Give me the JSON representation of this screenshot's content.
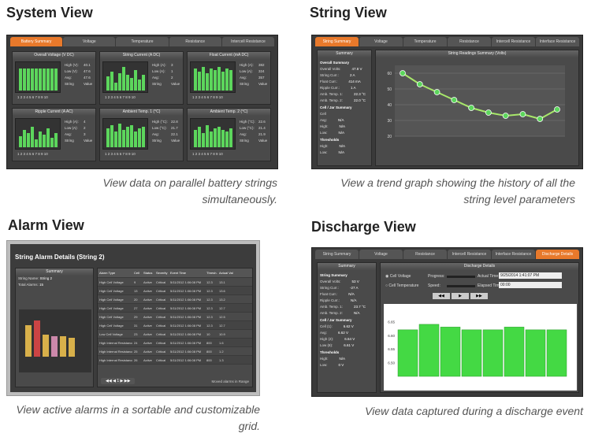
{
  "sections": {
    "system": {
      "title": "System View",
      "caption": "View data on parallel battery strings simultaneously.",
      "tabs": [
        "Battery Summary",
        "Voltage",
        "Temperature",
        "Resistance",
        "Intercell Resistance"
      ],
      "panels": [
        {
          "title": "Overall Voltage (V DC)",
          "axis": [
            "53.0",
            "47.5",
            "42.0",
            "36.5"
          ],
          "stats": [
            "High (V):",
            "40.1",
            "Low (V):",
            "47.6",
            "Avg:",
            "47.6",
            "String",
            "Value"
          ]
        },
        {
          "title": "String Current (A DC)",
          "axis": [
            "8.0",
            "4.0",
            "0.0",
            "-4.0"
          ],
          "stats": [
            "High (A):",
            "3",
            "Low (A):",
            "1",
            "Avg:",
            "2",
            "String",
            "Value"
          ]
        },
        {
          "title": "Float Current (mA DC)",
          "axis": [
            "432",
            "392",
            "352",
            "312"
          ],
          "stats": [
            "High (A):",
            "382",
            "Low (A):",
            "324",
            "Avg:",
            "357",
            "String",
            "Value"
          ]
        },
        {
          "title": "Ripple Current (A AC)",
          "axis": [
            "6.0",
            "4.0",
            "2.0",
            "0.0"
          ],
          "stats": [
            "High (A):",
            "4",
            "Low (A):",
            "2",
            "Avg:",
            "3",
            "String",
            "Value"
          ]
        },
        {
          "title": "Ambient Temp. 1 (°C)",
          "axis": [
            "23.0",
            "22.0",
            "21.0",
            "20.0"
          ],
          "stats": [
            "High (°C):",
            "22.8",
            "Low (°C):",
            "21.7",
            "Avg:",
            "22.1",
            "String",
            "Value"
          ]
        },
        {
          "title": "Ambient Temp. 2 (°C)",
          "axis": [
            "23.0",
            "22.0",
            "21.0",
            "20.0"
          ],
          "stats": [
            "High (°C):",
            "22.6",
            "Low (°C):",
            "21.4",
            "Avg:",
            "21.9",
            "String",
            "Value"
          ]
        }
      ],
      "xticks": "1 2 3 4 5 6 7 8 9 10"
    },
    "string": {
      "title": "String View",
      "caption": "View a trend graph showing the history of all the string level parameters",
      "tabs": [
        "String Summary",
        "Voltage",
        "Temperature",
        "Resistance",
        "Intercell Resistance",
        "Interface Resistance"
      ],
      "summary_head": "Summary",
      "chart_head": "String Readings Summary (Volts)",
      "summary": [
        {
          "label": "Overall Summary",
          "value": "",
          "head": true
        },
        {
          "label": "Overall Volts:",
          "value": "47.8 V"
        },
        {
          "label": "String Curr.:",
          "value": "2 A"
        },
        {
          "label": "Float Curr.:",
          "value": "414 mA"
        },
        {
          "label": "Ripple Curr.:",
          "value": "1 A"
        },
        {
          "label": "Amb. Temp. 1:",
          "value": "22.3 °C"
        },
        {
          "label": "Amb. Temp. 2:",
          "value": "22.0 °C"
        },
        {
          "label": "Cell / Jar Summary",
          "value": "",
          "head": true
        },
        {
          "label": "Cell",
          "value": ""
        },
        {
          "label": "Avg:",
          "value": "N/A"
        },
        {
          "label": "High:",
          "value": "N/A"
        },
        {
          "label": "Low:",
          "value": "N/A"
        },
        {
          "label": "Thresholds",
          "value": "",
          "head": true
        },
        {
          "label": "High:",
          "value": "N/A"
        },
        {
          "label": "Low:",
          "value": "N/A"
        }
      ]
    },
    "alarm": {
      "title": "Alarm View",
      "caption": "View active alarms in a sortable and customizable grid.",
      "header": "String Alarm Details (String 2)",
      "summary_head": "Summary",
      "string_name_label": "String Name:",
      "string_name": "String 2",
      "total_alarms_label": "Total Alarms:",
      "total_alarms": "15",
      "columns": [
        "Alarm Type",
        "Cell",
        "Status",
        "Severity",
        "Event Time",
        "Thresh. Value",
        "Actual Value"
      ],
      "rows": [
        [
          "High Cell Voltage",
          "9",
          "Active",
          "Critical",
          "5/11/2012 1:06:08 PM",
          "12.3",
          "13.1"
        ],
        [
          "High Cell Voltage",
          "13",
          "Active",
          "Critical",
          "5/11/2012 1:06:08 PM",
          "12.3",
          "13.6"
        ],
        [
          "High Cell Voltage",
          "20",
          "Active",
          "Critical",
          "5/11/2012 1:06:08 PM",
          "12.3",
          "13.2"
        ],
        [
          "High Cell Voltage",
          "27",
          "Active",
          "Critical",
          "5/11/2012 1:06:08 PM",
          "12.3",
          "12.7"
        ],
        [
          "High Cell Voltage",
          "29",
          "Active",
          "Critical",
          "5/11/2012 1:06:08 PM",
          "12.3",
          "12.5"
        ],
        [
          "High Cell Voltage",
          "31",
          "Active",
          "Critical",
          "5/11/2012 1:06:08 PM",
          "12.3",
          "12.7"
        ],
        [
          "Low Cell Voltage",
          "23",
          "Active",
          "Critical",
          "5/11/2012 1:06:08 PM",
          "10",
          "10.9"
        ],
        [
          "High Internal Resistance",
          "24",
          "Active",
          "Critical",
          "5/11/2012 1:06:08 PM",
          "800",
          "1.6"
        ],
        [
          "High Internal Resistance",
          "25",
          "Active",
          "Critical",
          "5/11/2012 1:06:08 PM",
          "800",
          "1.2"
        ],
        [
          "High Internal Resistance",
          "26",
          "Active",
          "Critical",
          "5/11/2012 1:06:08 PM",
          "800",
          "1.3"
        ]
      ],
      "pager": "1",
      "footer": "Moved alarms in Range"
    },
    "discharge": {
      "title": "Discharge View",
      "caption": "View data captured during a discharge event",
      "tabs": [
        "String Summary",
        "Voltage",
        "Resistance",
        "Intercell Resistance",
        "Interface Resistance",
        "Discharge Details"
      ],
      "summary_head": "Summary",
      "details_head": "Discharge Details",
      "summary": [
        {
          "label": "String Summary",
          "value": "",
          "head": true
        },
        {
          "label": "Overall Volts:",
          "value": "53 V"
        },
        {
          "label": "String Curr.:",
          "value": "-27 A"
        },
        {
          "label": "Float Curr.:",
          "value": "N/A"
        },
        {
          "label": "Ripple Curr.:",
          "value": "N/A"
        },
        {
          "label": "Amb. Temp. 1:",
          "value": "23.7 °C"
        },
        {
          "label": "Amb. Temp. 2:",
          "value": "N/A"
        },
        {
          "label": "Cell / Jar Summary",
          "value": "",
          "head": true
        },
        {
          "label": "Cell (1):",
          "value": "6.62 V"
        },
        {
          "label": "Avg:",
          "value": "6.62 V"
        },
        {
          "label": "High (2):",
          "value": "6.64 V"
        },
        {
          "label": "Low (8):",
          "value": "6.61 V"
        },
        {
          "label": "Thresholds",
          "value": "",
          "head": true
        },
        {
          "label": "High:",
          "value": "N/A"
        },
        {
          "label": "Low:",
          "value": "0 V"
        }
      ],
      "radio1": "Cell Voltage",
      "radio2": "Cell Temperature",
      "progress_label": "Progress:",
      "speed_label": "Speed:",
      "actual_time_label": "Actual Time:",
      "actual_time": "9/25/2014 1:41:07 PM",
      "elapsed_time_label": "Elapsed Time:",
      "elapsed_time": "00:00",
      "yticks": [
        "6.65",
        "6.60",
        "6.55",
        "6.50"
      ]
    }
  },
  "colors": {
    "accent": "#e8792b",
    "bar": "#5cd65c",
    "panel": "#3a3a3a"
  }
}
